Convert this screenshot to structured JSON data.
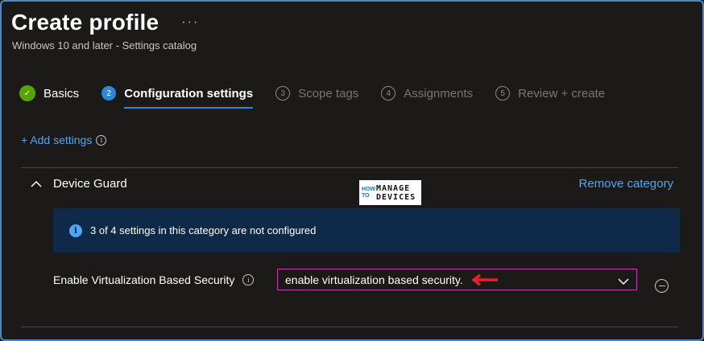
{
  "header": {
    "title": "Create profile",
    "more": "···",
    "subtitle": "Windows 10 and later - Settings catalog"
  },
  "steps": [
    {
      "number": "✓",
      "label": "Basics",
      "state": "done"
    },
    {
      "number": "2",
      "label": "Configuration settings",
      "state": "active"
    },
    {
      "number": "3",
      "label": "Scope tags",
      "state": "pending"
    },
    {
      "number": "4",
      "label": "Assignments",
      "state": "pending"
    },
    {
      "number": "5",
      "label": "Review + create",
      "state": "pending"
    }
  ],
  "add_settings": {
    "label": "+ Add settings",
    "info": "i"
  },
  "category": {
    "name": "Device Guard",
    "remove_label": "Remove category",
    "banner_icon": "i",
    "banner_text": "3 of 4 settings in this category are not configured"
  },
  "logo": {
    "small_top": "HOW",
    "small_bottom": "TO",
    "line1": "MANAGE",
    "line2": "DEVICES"
  },
  "setting": {
    "label": "Enable Virtualization Based Security",
    "info": "i",
    "value": "enable virtualization based security."
  },
  "colors": {
    "accent": "#2b88d8",
    "link": "#4fa6f2",
    "success": "#57a300",
    "focus_border": "#c239b3",
    "annotation_arrow": "#e8202a"
  }
}
